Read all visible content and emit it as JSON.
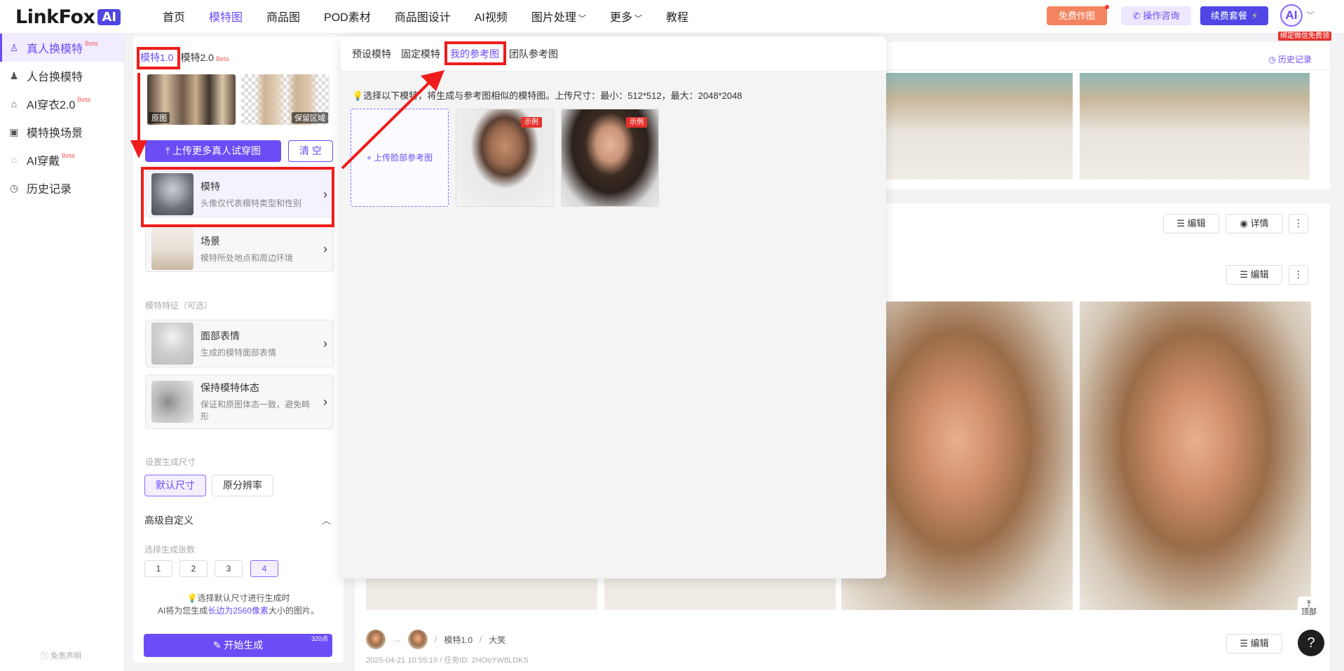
{
  "nav": {
    "logo_text": "LinkFox",
    "logo_badge": "AI",
    "items": [
      {
        "label": "首页",
        "caret": false
      },
      {
        "label": "模特图",
        "caret": false,
        "active": true
      },
      {
        "label": "商品图",
        "caret": false
      },
      {
        "label": "POD素材",
        "caret": false
      },
      {
        "label": "商品图设计",
        "caret": false
      },
      {
        "label": "AI视频",
        "caret": false
      },
      {
        "label": "图片处理",
        "caret": true
      },
      {
        "label": "更多",
        "caret": true
      },
      {
        "label": "教程",
        "caret": false
      }
    ],
    "free_btn": "免费作图",
    "consult_btn": "操作咨询",
    "plan_btn": "续费套餐",
    "avatar_text": "AI",
    "bind_tag": "绑定微信免费领"
  },
  "sidebar": {
    "items": [
      {
        "label": "真人换模特",
        "beta": "Beta",
        "icon": "person-swap-icon",
        "active": true
      },
      {
        "label": "人台换模特",
        "beta": "",
        "icon": "mannequin-icon"
      },
      {
        "label": "AI穿衣2.0",
        "beta": "Beta",
        "icon": "shirt-icon"
      },
      {
        "label": "模特换场景",
        "beta": "",
        "icon": "scene-icon"
      },
      {
        "label": "AI穿戴",
        "beta": "Beta",
        "icon": "ring-icon"
      },
      {
        "label": "历史记录",
        "beta": "",
        "icon": "history-icon"
      }
    ],
    "disclaimer": "免责声明"
  },
  "config": {
    "ver_tabs": [
      {
        "label": "模特1.0",
        "active": true
      },
      {
        "label": "模特2.0",
        "beta": "Beta"
      }
    ],
    "thumb_orig": "原图",
    "thumb_keep": "保留区域",
    "upload_btn": "上传更多真人试穿图",
    "clear_btn": "清 空",
    "options": [
      {
        "title": "模特",
        "desc": "头像仅代表模特类型和性别"
      },
      {
        "title": "场景",
        "desc": "模特所处地点和周边环境"
      }
    ],
    "feature_label": "模特特征（可选）",
    "features": [
      {
        "title": "面部表情",
        "desc": "生成的模特面部表情"
      },
      {
        "title": "保持模特体态",
        "desc": "保证和原图体态一致，避免畸形"
      }
    ],
    "size_label": "设置生成尺寸",
    "size_options": [
      {
        "label": "默认尺寸",
        "active": true
      },
      {
        "label": "原分辨率"
      }
    ],
    "advanced_title": "高级自定义",
    "count_label": "选择生成张数",
    "count_options": [
      {
        "label": "1"
      },
      {
        "label": "2"
      },
      {
        "label": "3"
      },
      {
        "label": "4",
        "active": true
      }
    ],
    "hint_line1": "选择默认尺寸进行生成时",
    "hint_line2_a": "AI将为您生成",
    "hint_line2_hl": "长边为2560像素",
    "hint_line2_b": "大小的图片。",
    "generate_btn": "开始生成",
    "generate_points": "320点"
  },
  "popup": {
    "tabs": [
      {
        "label": "预设模特"
      },
      {
        "label": "固定模特"
      },
      {
        "label": "我的参考图",
        "active": true
      },
      {
        "label": "团队参考图"
      }
    ],
    "note": "选择以下模特，将生成与参考图相似的模特图。上传尺寸：最小：512*512，最大：2048*2048",
    "upload_label": "+ 上传脸部参考图",
    "refs": [
      {
        "tag": "示例"
      },
      {
        "tag": "示例"
      }
    ]
  },
  "content": {
    "history_link": "历史记录",
    "edit_label": "编辑",
    "detail_label": "详情",
    "more_label": "⋮",
    "meta_model": "模特1.0",
    "meta_expr": "大笑",
    "meta_time": "2025-04-21 10:55:19 / 任务ID: 2HOoYW8LDKS",
    "top_label": "顶部",
    "help_label": "?"
  }
}
